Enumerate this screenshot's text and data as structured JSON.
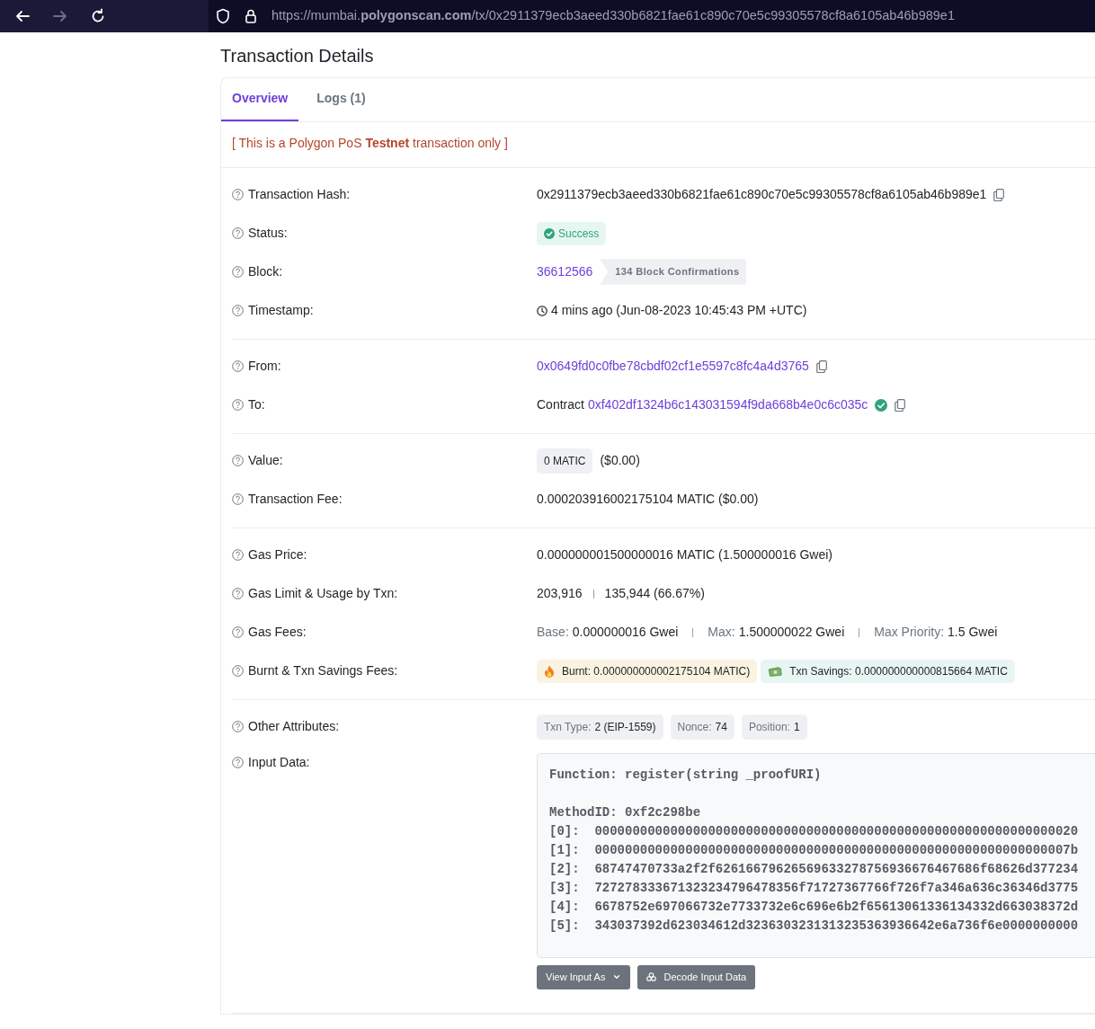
{
  "browser": {
    "url": "https://mumbai.**polygonscan.com**/tx/0x2911379ecb3aeed330b6821fae61c890c70e5c99305578cf8a6105ab46b989e1",
    "forward_disabled": true
  },
  "title": "Transaction Details",
  "tabs": [
    {
      "label": "Overview",
      "selected": true
    },
    {
      "label": "Logs (1)",
      "selected": false
    }
  ],
  "notice": "[ This is a Polygon PoS **Testnet** transaction only ]",
  "sections": [
    {
      "rows": [
        {
          "label": "Transaction Hash:",
          "kind": "hash",
          "text": "0x2911379ecb3aeed330b6821fae61c890c70e5c99305578cf8a6105ab46b989e1"
        },
        {
          "label": "Status:",
          "kind": "status",
          "text": "Success"
        },
        {
          "label": "Block:",
          "kind": "block",
          "link": "36612566",
          "badge": "134 Block Confirmations"
        },
        {
          "label": "Timestamp:",
          "kind": "time",
          "text": "4 mins ago (Jun-08-2023 10:45:43 PM +UTC)"
        }
      ]
    },
    {
      "rows": [
        {
          "label": "From:",
          "kind": "address",
          "link": "0x0649fd0c0fbe78cbdf02cf1e5597c8fc4a4d3765"
        },
        {
          "label": "To:",
          "kind": "contract",
          "prefix": "Contract",
          "link": "0xf402df1324b6c143031594f9da668b4e0c6c035c",
          "verified": true
        }
      ]
    },
    {
      "rows": [
        {
          "label": "Value:",
          "kind": "value",
          "pill": "0 MATIC",
          "text": "($0.00)"
        },
        {
          "label": "Transaction Fee:",
          "kind": "text",
          "text": "0.000203916002175104 MATIC ($0.00)"
        }
      ]
    },
    {
      "rows": [
        {
          "label": "Gas Price:",
          "kind": "text",
          "text": "0.000000001500000016 MATIC (1.500000016 Gwei)"
        },
        {
          "label": "Gas Limit & Usage by Txn:",
          "kind": "split",
          "parts": [
            "203,916",
            "135,944 (66.67%)"
          ]
        },
        {
          "label": "Gas Fees:",
          "kind": "pairs",
          "items": [
            {
              "key": "Base:",
              "value": "0.000000016 Gwei"
            },
            {
              "key": "Max:",
              "value": "1.500000022 Gwei"
            },
            {
              "key": "Max Priority:",
              "value": "1.5 Gwei"
            }
          ]
        },
        {
          "label": "Burnt & Txn Savings Fees:",
          "kind": "tags",
          "items": [
            {
              "kind": "burnt",
              "text": "Burnt: 0.000000000002175104 MATIC)",
              "color": "#fbf3e1"
            },
            {
              "kind": "savings",
              "text": "Txn Savings: 0.000000000000815664 MATIC",
              "color": "#e8f6f3"
            }
          ]
        }
      ]
    },
    {
      "rows": [
        {
          "label": "Other Attributes:",
          "kind": "attrs",
          "items": [
            {
              "key": "Txn Type:",
              "value": "2 (EIP-1559)"
            },
            {
              "key": "Nonce:",
              "value": "74"
            },
            {
              "key": "Position:",
              "value": "1"
            }
          ]
        },
        {
          "label": "Input Data:",
          "kind": "input",
          "function": "Function: register(string _proofURI)",
          "method": "MethodID: 0xf2c298be",
          "params": [
            "[0]:  0000000000000000000000000000000000000000000000000000000000000020",
            "[1]:  000000000000000000000000000000000000000000000000000000000000007b",
            "[2]:  68747470733a2f2f62616679626569633278756936676467686f68626d377234",
            "[3]:  727278333671323234796478356f71727367766f726f7a346a636c36346d3775",
            "[4]:  6678752e697066732e7733732e6c696e6b2f65613061336134332d663038372d",
            "[5]:  343037392d623034612d3236303231313235363936642e6a736f6e0000000000"
          ],
          "buttons": [
            {
              "label": "View Input As",
              "dropdown": true
            },
            {
              "label": "Decode Input Data",
              "dropdown": false
            }
          ]
        }
      ]
    }
  ]
}
